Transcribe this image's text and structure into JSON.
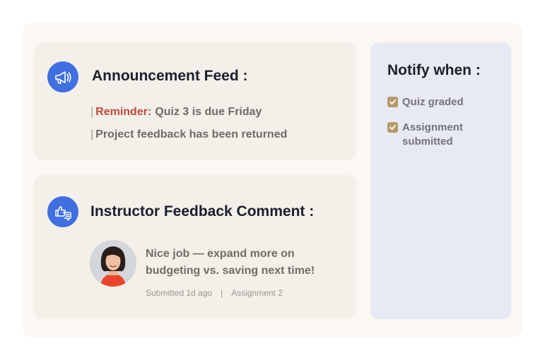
{
  "announcements": {
    "title": "Announcement Feed :",
    "icon": "megaphone-icon",
    "items": [
      {
        "prefix": "Reminder:",
        "text": "Quiz 3 is due Friday"
      },
      {
        "prefix": "",
        "text": "Project feedback has been returned"
      }
    ],
    "separator": "|",
    "reminder_color": "#c24a3e"
  },
  "feedback": {
    "title": "Instructor Feedback Comment :",
    "icon": "thumbs-up-chat-icon",
    "comment": "Nice job — expand more on budgeting vs. saving next time!",
    "submitted": "Submitted 1d ago",
    "meta_separator": "|",
    "assignment": "Assignment 2"
  },
  "notify": {
    "title": "Notify when :",
    "options": [
      {
        "label": "Quiz graded",
        "checked": true
      },
      {
        "label": "Assignment submitted",
        "checked": true
      }
    ],
    "check_color": "#b89a68"
  },
  "colors": {
    "accent_blue": "#3f6fe0",
    "card_bg": "#f3f0ea",
    "side_bg": "#e7eaf3"
  }
}
